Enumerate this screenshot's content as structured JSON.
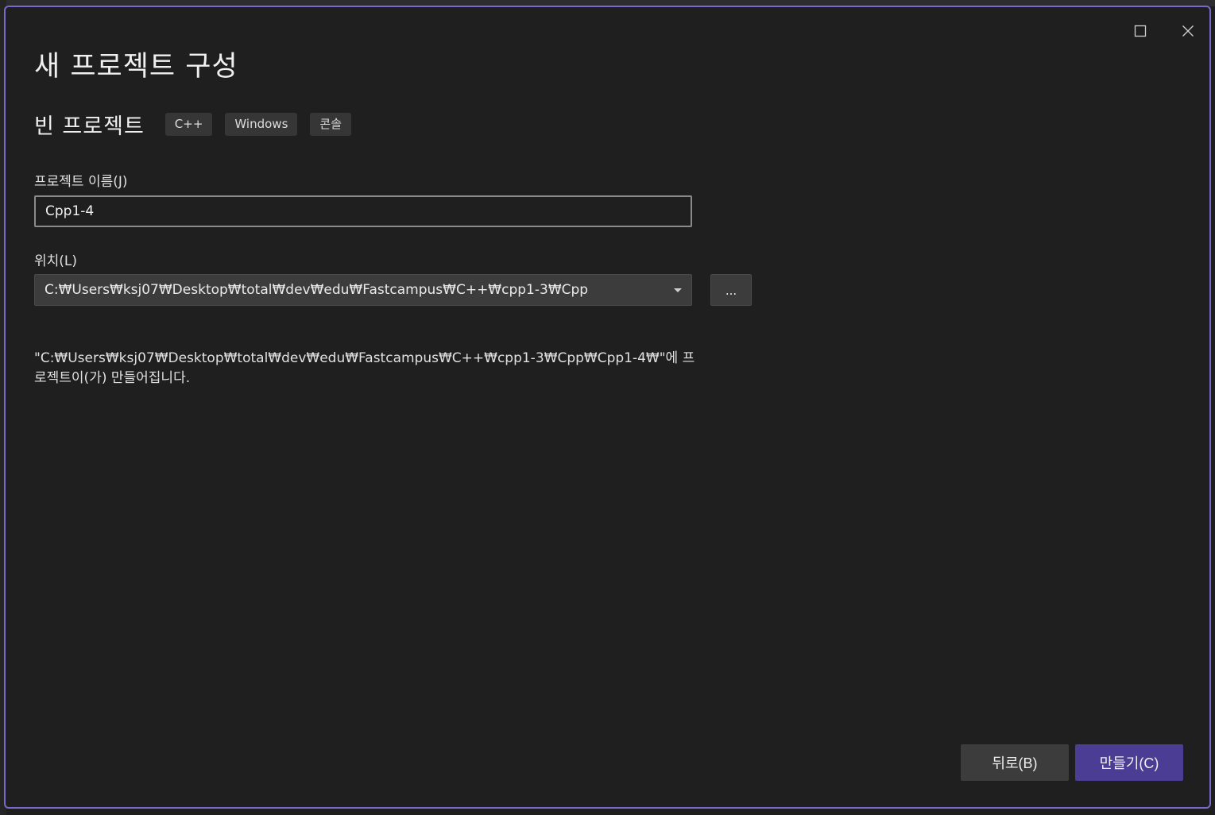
{
  "dialog": {
    "title": "새 프로젝트 구성",
    "template": {
      "name": "빈 프로젝트",
      "tags": [
        "C++",
        "Windows",
        "콘솔"
      ]
    },
    "project_name": {
      "label": "프로젝트 이름(J)",
      "value": "Cpp1-4"
    },
    "location": {
      "label": "위치(L)",
      "value": "C:₩Users₩ksj07₩Desktop₩total₩dev₩edu₩Fastcampus₩C++₩cpp1-3₩Cpp",
      "browse_label": "..."
    },
    "create_info": "\"C:₩Users₩ksj07₩Desktop₩total₩dev₩edu₩Fastcampus₩C++₩cpp1-3₩Cpp₩Cpp1-4₩\"에 프로젝트이(가) 만들어집니다.",
    "buttons": {
      "back": "뒤로(B)",
      "create": "만들기(C)"
    },
    "window_controls": [
      "maximize-icon",
      "close-icon"
    ],
    "colors": {
      "accent_border": "#7b68c8",
      "primary_button": "#4b3d93",
      "background": "#1f1f1f"
    }
  }
}
